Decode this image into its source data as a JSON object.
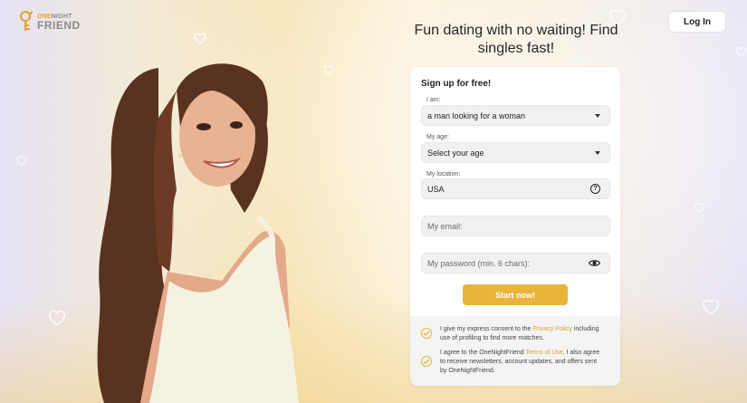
{
  "brand": {
    "small_one": "ONE",
    "small_night": "NIGHT",
    "big": "FRIEND"
  },
  "header": {
    "login_label": "Log In"
  },
  "hero": {
    "headline": "Fun dating with no waiting! Find singles fast!"
  },
  "signup": {
    "title": "Sign up for free!",
    "iam": {
      "label": "I am:",
      "value": "a man looking for a woman"
    },
    "age": {
      "label": "My age:",
      "value": "Select your age"
    },
    "location": {
      "label": "My location:",
      "value": "USA"
    },
    "email": {
      "placeholder": "My email:"
    },
    "password": {
      "placeholder": "My password (min. 6 chars):"
    },
    "submit_label": "Start now!",
    "consent1": {
      "pre": "I give my express consent to the ",
      "link": "Privacy Policy",
      "post": " including use of profiling to find more matches."
    },
    "consent2": {
      "pre": "I agree to the OneNightFriend ",
      "link": "Terms of Use",
      "post": ". I also agree to receive newsletters, account updates, and offers sent by OneNightFriend."
    }
  },
  "colors": {
    "accent": "#e8b53a",
    "link": "#d9a22a",
    "text": "#262626"
  },
  "icons": [
    "key-logo-icon",
    "heart-icon",
    "chevron-down-icon",
    "help-icon",
    "eye-icon",
    "check-icon"
  ]
}
